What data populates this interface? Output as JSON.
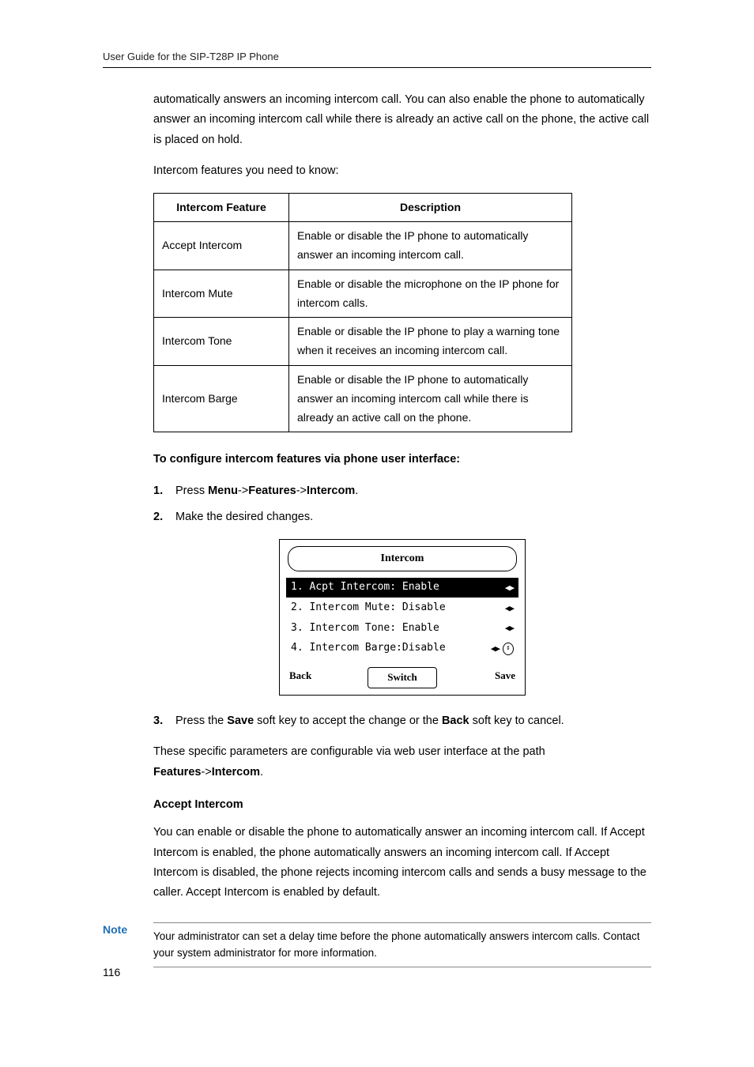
{
  "header": {
    "running_title": "User Guide for the SIP-T28P IP Phone"
  },
  "intro": {
    "p1": "automatically answers an incoming intercom call. You can also enable the phone to automatically answer an incoming intercom call while there is already an active call on the phone, the active call is placed on hold.",
    "p2": "Intercom features you need to know:"
  },
  "table": {
    "col1_header": "Intercom Feature",
    "col2_header": "Description",
    "rows": [
      {
        "feature": "Accept Intercom",
        "desc": "Enable or disable the IP phone to automatically answer an incoming intercom call."
      },
      {
        "feature": "Intercom Mute",
        "desc": "Enable or disable the microphone on the IP phone for intercom calls."
      },
      {
        "feature": "Intercom Tone",
        "desc": "Enable or disable the IP phone to play a warning tone when it receives an incoming intercom call."
      },
      {
        "feature": "Intercom Barge",
        "desc": "Enable or disable the IP phone to automatically answer an incoming intercom call while there is already an active call on the phone."
      }
    ]
  },
  "config_heading": "To configure intercom features via phone user interface:",
  "steps": {
    "s1_prefix": "Press ",
    "s1_menu": "Menu",
    "s1_sep1": "->",
    "s1_features": "Features",
    "s1_sep2": "->",
    "s1_intercom": "Intercom",
    "s1_suffix": ".",
    "s2": "Make the desired changes.",
    "s3_prefix": "Press the ",
    "s3_save": "Save",
    "s3_mid": " soft key to accept the change or the ",
    "s3_back": "Back",
    "s3_suffix": " soft key to cancel."
  },
  "lcd": {
    "title": "Intercom",
    "rows": [
      {
        "label": "1. Acpt Intercom:  Enable",
        "selected": true,
        "scroll": false
      },
      {
        "label": "2.  Intercom Mute:  Disable",
        "selected": false,
        "scroll": false
      },
      {
        "label": "3.  Intercom Tone:  Enable",
        "selected": false,
        "scroll": false
      },
      {
        "label": "4.  Intercom Barge:Disable",
        "selected": false,
        "scroll": true
      }
    ],
    "sk_back": "Back",
    "sk_switch": "Switch",
    "sk_save": "Save"
  },
  "post": {
    "p1_prefix": "These specific parameters are configurable via web user interface at the path ",
    "p1_path1": "Features",
    "p1_sep": "->",
    "p1_path2": "Intercom",
    "p1_suffix": "."
  },
  "accept_section": {
    "heading": "Accept Intercom",
    "body": "You can enable or disable the phone to automatically answer an incoming intercom call. If Accept Intercom is enabled, the phone automatically answers an incoming intercom call. If Accept Intercom is disabled, the phone rejects incoming intercom calls and sends a busy message to the caller. Accept Intercom is enabled by default."
  },
  "note": {
    "label": "Note",
    "text": "Your administrator can set a delay time before the phone automatically answers intercom calls. Contact your system administrator for more information."
  },
  "page_number": "116"
}
